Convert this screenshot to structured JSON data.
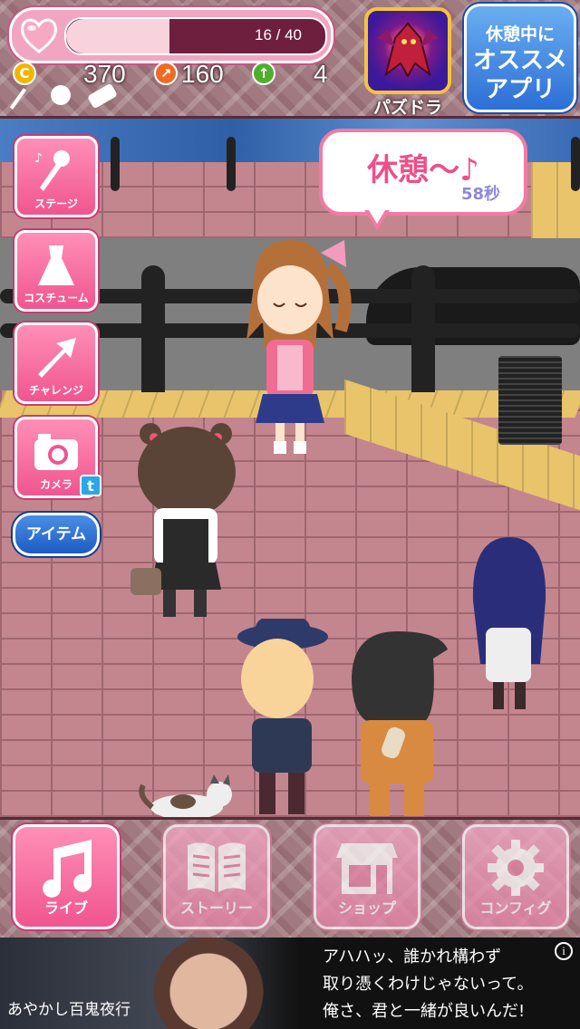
{
  "status": {
    "hp_text": "16 / 40",
    "hp_fraction": 0.4,
    "coins": "370",
    "challenge": "160",
    "level": "4"
  },
  "promo": {
    "app_label": "パズドラ",
    "recommend_line1": "休憩中に",
    "recommend_line2": "オススメ",
    "recommend_line3": "アプリ"
  },
  "bubble": {
    "message": "休憩〜♪",
    "timer": "58秒"
  },
  "side_menu": {
    "stage": "ステージ",
    "costume": "コスチューム",
    "challenge": "チャレンジ",
    "camera": "カメラ",
    "item": "アイテム"
  },
  "nav": {
    "live": "ライブ",
    "story": "ストーリー",
    "shop": "ショップ",
    "config": "コンフィグ"
  },
  "ad": {
    "logo": "あやかし百鬼夜行",
    "line1": "アハハッ、誰かれ構わず",
    "line2": "取り憑くわけじゃないって。",
    "line3": "俺さ、君と一緒が良いんだ!"
  },
  "colors": {
    "pink_button": "#f0558f",
    "blue_button": "#2d6fd6",
    "hp_track": "#6e1f3d"
  }
}
